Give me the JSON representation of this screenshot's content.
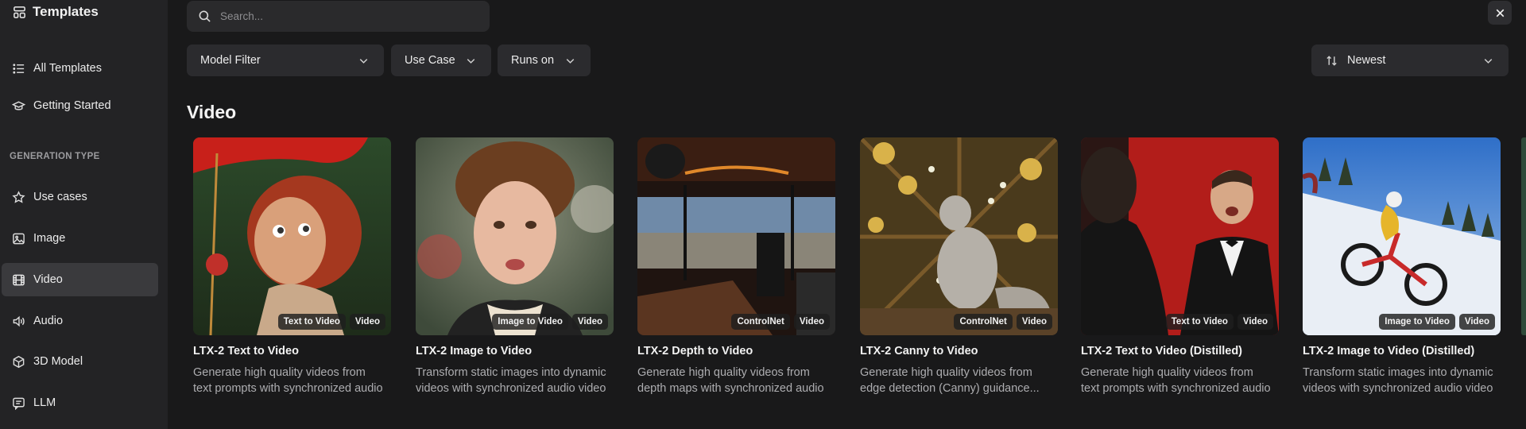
{
  "sidebar": {
    "title": "Templates",
    "items_top": [
      {
        "label": "All Templates",
        "icon": "list-icon"
      },
      {
        "label": "Getting Started",
        "icon": "graduation-cap-icon"
      }
    ],
    "section_label": "GENERATION TYPE",
    "items": [
      {
        "label": "Use cases",
        "icon": "star-icon"
      },
      {
        "label": "Image",
        "icon": "image-icon"
      },
      {
        "label": "Video",
        "icon": "film-icon",
        "active": true
      },
      {
        "label": "Audio",
        "icon": "speaker-icon"
      },
      {
        "label": "3D Model",
        "icon": "cube-icon"
      },
      {
        "label": "LLM",
        "icon": "chat-icon"
      }
    ]
  },
  "search": {
    "placeholder": "Search...",
    "value": ""
  },
  "filters": {
    "model": "Model Filter",
    "use_case": "Use Case",
    "runs_on": "Runs on",
    "sort": "Newest"
  },
  "section_title": "Video",
  "cards": [
    {
      "title": "LTX-2 Text to Video",
      "desc1": "Generate high quality videos from",
      "desc2": "text prompts with synchronized audio",
      "tags": [
        "Text to Video",
        "Video"
      ]
    },
    {
      "title": "LTX-2 Image to Video",
      "desc1": "Transform static images into dynamic",
      "desc2": "videos with synchronized audio video",
      "tags": [
        "Image to Video",
        "Video"
      ]
    },
    {
      "title": "LTX-2 Depth to Video",
      "desc1": "Generate high quality videos from",
      "desc2": "depth maps with synchronized audio",
      "tags": [
        "ControlNet",
        "Video"
      ]
    },
    {
      "title": "LTX-2 Canny to Video",
      "desc1": "Generate high quality videos from",
      "desc2": "edge detection (Canny) guidance...",
      "tags": [
        "ControlNet",
        "Video"
      ]
    },
    {
      "title": "LTX-2 Text to Video (Distilled)",
      "desc1": "Generate high quality videos from",
      "desc2": "text prompts with synchronized audio",
      "tags": [
        "Text to Video",
        "Video"
      ]
    },
    {
      "title": "LTX-2 Image to Video (Distilled)",
      "desc1": "Transform static images into dynamic",
      "desc2": "videos with synchronized audio video",
      "tags": [
        "Image to Video",
        "Video"
      ]
    }
  ],
  "colors": {
    "sidebar_bg": "#232325",
    "main_bg": "#19191a",
    "active_item": "#3a3a3d",
    "control_bg": "#2b2b2e"
  }
}
